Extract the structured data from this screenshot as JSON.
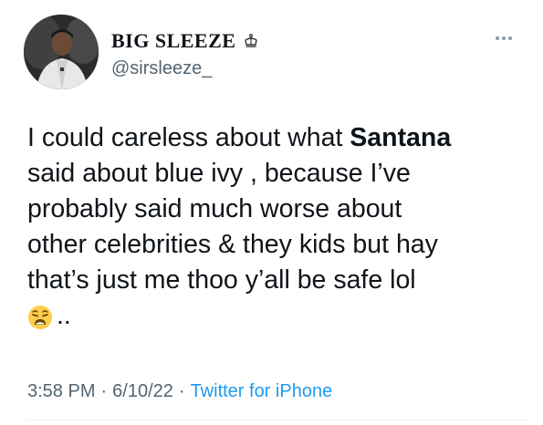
{
  "author": {
    "display_name": "BIG SLEEZE",
    "handle": "@sirsleeze_",
    "avatar_icon": "profile-photo",
    "badge_icon": "crown-icon"
  },
  "menu": {
    "icon": "more-horizontal-icon"
  },
  "tweet": {
    "line1_prefix": "I could careless about what ",
    "line1_bold": "Santana",
    "line2": "said about blue ivy , because I’ve",
    "line3": "probably said much worse about",
    "line4": "other celebrities & they kids but hay",
    "line5": "that’s just me thoo y’all be safe lol",
    "trailing": "..",
    "emoji": "weary-face-emoji"
  },
  "meta": {
    "time": "3:58 PM",
    "date": "6/10/22",
    "separator": "·",
    "source": "Twitter for iPhone"
  },
  "colors": {
    "text": "#0f1419",
    "secondary": "#536471",
    "link": "#1d9bf0"
  }
}
